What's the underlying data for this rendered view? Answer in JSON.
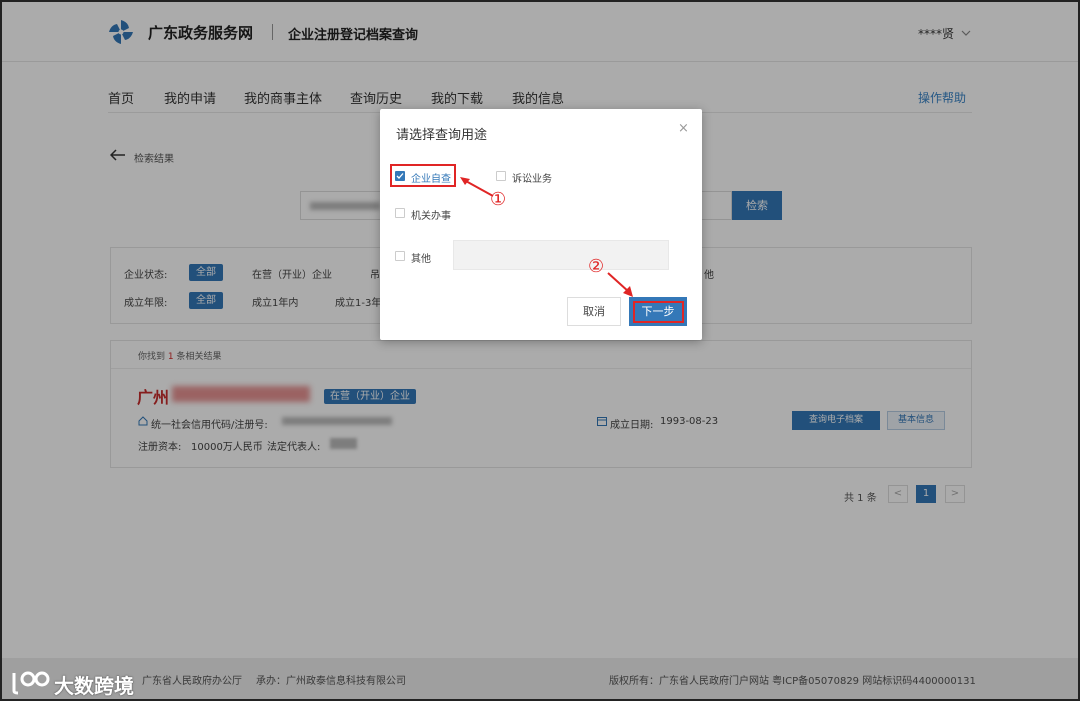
{
  "header": {
    "site_name": "广东政务服务网",
    "sub_name": "企业注册登记档案查询",
    "user": "****贤"
  },
  "nav": {
    "items": [
      "首页",
      "我的申请",
      "我的商事主体",
      "查询历史",
      "我的下载",
      "我的信息"
    ],
    "help": "操作帮助"
  },
  "back": {
    "label": "检索结果"
  },
  "search": {
    "button": "检索"
  },
  "filters": {
    "status_label": "企业状态:",
    "status_active": "全部",
    "status_opt1": "在营（开业）企业",
    "status_opt2": "吊",
    "status_opt_end": "他",
    "year_label": "成立年限:",
    "year_active": "全部",
    "year_opt1": "成立1年内",
    "year_opt2": "成立1-3年"
  },
  "results": {
    "found_prefix": "你找到",
    "found_count": "1",
    "found_suffix": "条相关结果",
    "company_name": "广州",
    "company_status": "在营（开业）企业",
    "credit_code_label": "统一社会信用代码/注册号:",
    "est_date_label": "成立日期:",
    "est_date": "1993-08-23",
    "capital_label": "注册资本:",
    "capital": "10000万人民币",
    "legal_rep_label": "法定代表人:",
    "btn_archive": "查询电子档案",
    "btn_basic": "基本信息"
  },
  "pager": {
    "total": "共 1 条",
    "prev": "<",
    "current": "1",
    "next": ">"
  },
  "footer": {
    "host": "广东省人民政府办公厅",
    "operator": "承办：广州政泰信息科技有限公司",
    "copyright": "版权所有：广东省人民政府门户网站 粤ICP备05070829 网站标识码4400000131",
    "watermark": "大数跨境"
  },
  "modal": {
    "title": "请选择查询用途",
    "close": "×",
    "options": [
      {
        "label": "企业自查",
        "checked": true
      },
      {
        "label": "诉讼业务",
        "checked": false
      },
      {
        "label": "机关办事",
        "checked": false
      },
      {
        "label": "其他",
        "checked": false
      }
    ],
    "cancel": "取消",
    "next": "下一步",
    "mark1": "①",
    "mark2": "②"
  },
  "colors": {
    "primary": "#3478b8",
    "highlight": "#e02525"
  }
}
